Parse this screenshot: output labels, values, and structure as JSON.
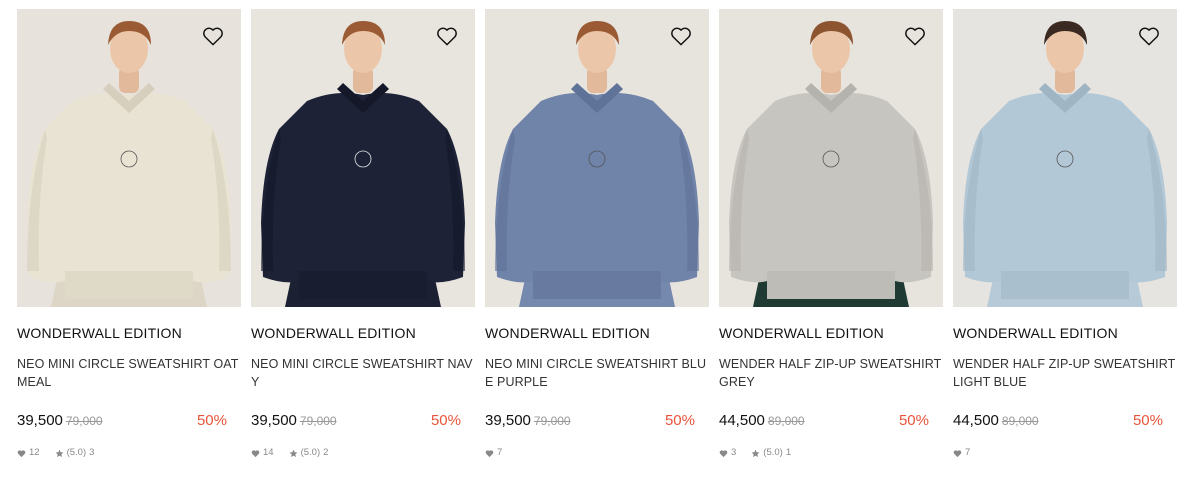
{
  "products": [
    {
      "brand": "WONDERWALL EDITION",
      "name": "NEO MINI CIRCLE SWEATSHIRT OATMEAL",
      "price": "39,500",
      "original_price": "79,000",
      "discount": "50%",
      "likes": "12",
      "rating": "(5.0)",
      "reviews": "3",
      "colors": {
        "bg": "#e7e3dc",
        "garment": "#e9e3d3",
        "shade": "#d6cfbe",
        "pants": "#ddd6c6",
        "hair": "#9a5b34"
      }
    },
    {
      "brand": "WONDERWALL EDITION",
      "name": "NEO MINI CIRCLE SWEATSHIRT NAVY",
      "price": "39,500",
      "original_price": "79,000",
      "discount": "50%",
      "likes": "14",
      "rating": "(5.0)",
      "reviews": "2",
      "colors": {
        "bg": "#e8e4de",
        "garment": "#1d2236",
        "shade": "#141829",
        "pants": "#1b2033",
        "hair": "#9a5b34"
      }
    },
    {
      "brand": "WONDERWALL EDITION",
      "name": "NEO MINI CIRCLE SWEATSHIRT BLUE PURPLE",
      "price": "39,500",
      "original_price": "79,000",
      "discount": "50%",
      "likes": "7",
      "rating": "",
      "reviews": "",
      "colors": {
        "bg": "#e7e3dd",
        "garment": "#7083a8",
        "shade": "#5f7297",
        "pants": "#7588ad",
        "hair": "#9a5b34"
      }
    },
    {
      "brand": "WONDERWALL EDITION",
      "name": "WENDER HALF ZIP-UP SWEATSHIRT GREY",
      "price": "44,500",
      "original_price": "89,000",
      "discount": "50%",
      "likes": "3",
      "rating": "(5.0)",
      "reviews": "1",
      "colors": {
        "bg": "#e7e3dd",
        "garment": "#c7c5c0",
        "shade": "#b5b3ae",
        "pants": "#1f3a33",
        "hair": "#8c5530"
      }
    },
    {
      "brand": "WONDERWALL EDITION",
      "name": "WENDER HALF ZIP-UP SWEATSHIRT LIGHT BLUE",
      "price": "44,500",
      "original_price": "89,000",
      "discount": "50%",
      "likes": "7",
      "rating": "",
      "reviews": "",
      "colors": {
        "bg": "#e6e4e0",
        "garment": "#b3c8d6",
        "shade": "#9fb5c4",
        "pants": "#b6cad8",
        "hair": "#3b2a22"
      }
    }
  ],
  "icons": {
    "wishlist": "heart-outline-icon",
    "likes": "heart-icon",
    "rating": "star-icon"
  }
}
